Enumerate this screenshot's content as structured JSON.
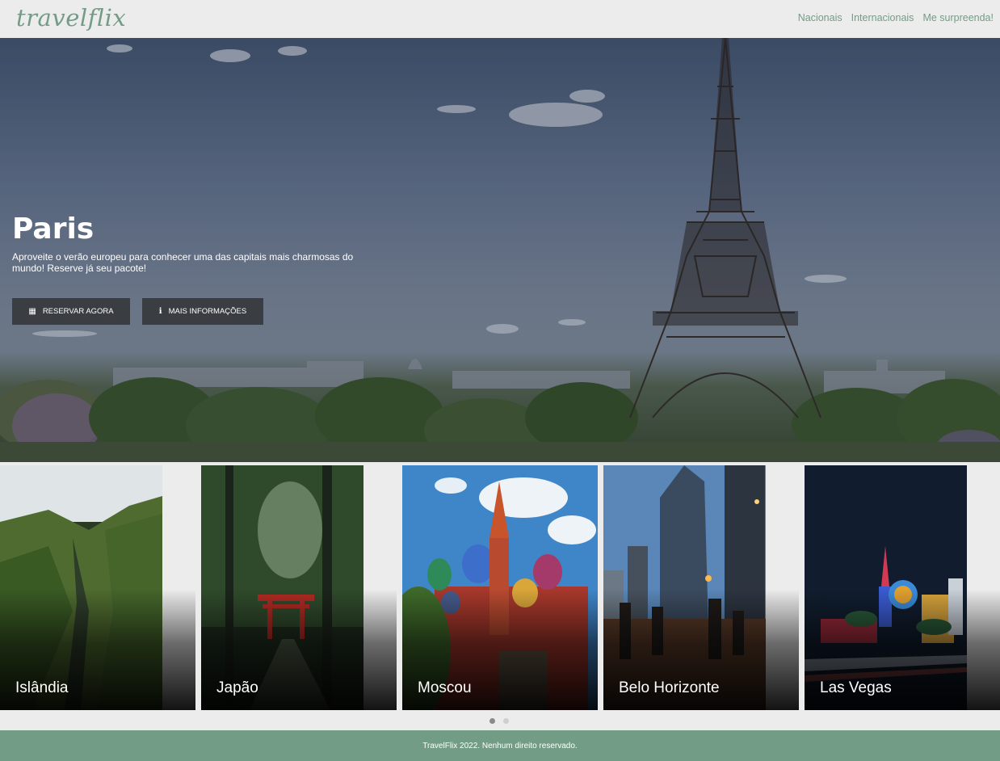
{
  "header": {
    "logo": "travelflix",
    "nav": [
      "Nacionais",
      "Internacionais",
      "Me surpreenda!"
    ]
  },
  "hero": {
    "title": "Paris",
    "description": "Aproveite o verão europeu para conhecer uma das capitais mais charmosas do mundo! Reserve já seu pacote!",
    "buttons": {
      "reserve": "RESERVAR AGORA",
      "info": "MAIS INFORMAÇÕES"
    }
  },
  "cards": [
    {
      "label": "Islândia"
    },
    {
      "label": "Japão"
    },
    {
      "label": "Moscou"
    },
    {
      "label": "Belo Horizonte"
    },
    {
      "label": "Las Vegas"
    }
  ],
  "carousel": {
    "pages": 2,
    "active": 1
  },
  "footer": {
    "text": "TravelFlix 2022. Nenhum direito reservado."
  },
  "colors": {
    "brand": "#739c87",
    "button": "#3a3d42",
    "page_bg": "#ececec"
  }
}
